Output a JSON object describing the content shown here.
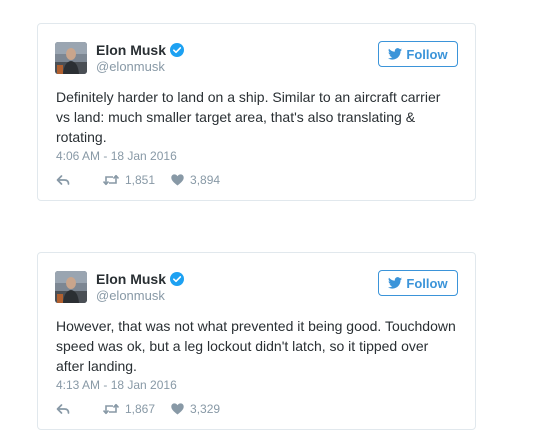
{
  "colors": {
    "accent": "#3b94d9",
    "verified": "#1da1f2",
    "muted": "#8899a6",
    "text": "#292f33",
    "border": "#e1e8ed"
  },
  "tweets": [
    {
      "author": {
        "name": "Elon Musk",
        "handle": "@elonmusk",
        "verified_icon": "verified-badge-icon",
        "avatar_icon": "avatar"
      },
      "follow_label": "Follow",
      "follow_icon": "twitter-bird-icon",
      "text": "Definitely harder to land on a ship. Similar to an aircraft carrier vs land: much smaller target area, that's also translating & rotating.",
      "timestamp": "4:06 AM - 18 Jan 2016",
      "actions": {
        "reply_icon": "reply-icon",
        "retweet_icon": "retweet-icon",
        "retweets": "1,851",
        "like_icon": "heart-icon",
        "likes": "3,894"
      }
    },
    {
      "author": {
        "name": "Elon Musk",
        "handle": "@elonmusk",
        "verified_icon": "verified-badge-icon",
        "avatar_icon": "avatar"
      },
      "follow_label": "Follow",
      "follow_icon": "twitter-bird-icon",
      "text": "However, that was not what prevented it being good. Touchdown speed was ok, but a leg lockout didn't latch, so it tipped over after landing.",
      "timestamp": "4:13 AM - 18 Jan 2016",
      "actions": {
        "reply_icon": "reply-icon",
        "retweet_icon": "retweet-icon",
        "retweets": "1,867",
        "like_icon": "heart-icon",
        "likes": "3,329"
      }
    }
  ]
}
